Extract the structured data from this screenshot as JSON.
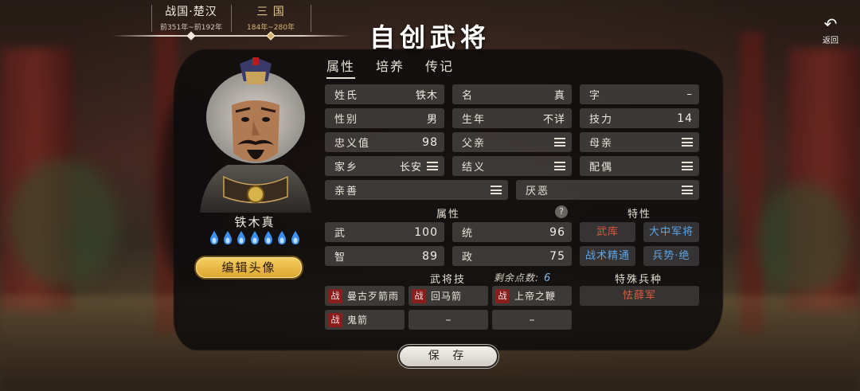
{
  "eras": [
    {
      "name": "战国·楚汉",
      "years": "前351年~前192年",
      "active": false
    },
    {
      "name": "三 国",
      "years": "184年~280年",
      "active": true
    }
  ],
  "title": "自创武将",
  "back_label": "返回",
  "tabs": [
    "属性",
    "培养",
    "传记"
  ],
  "general": {
    "name": "铁木真",
    "gem_count": 7,
    "edit_avatar_label": "编辑头像"
  },
  "info": {
    "surname_label": "姓氏",
    "surname": "铁木",
    "given_label": "名",
    "given": "真",
    "courtesy_label": "字",
    "courtesy": "–",
    "gender_label": "性别",
    "gender": "男",
    "birth_label": "生年",
    "birth": "不详",
    "skill_pts_label": "技力",
    "skill_pts": "14",
    "loyalty_label": "忠义值",
    "loyalty": "98",
    "father_label": "父亲",
    "mother_label": "母亲",
    "hometown_label": "家乡",
    "hometown": "长安",
    "sworn_label": "结义",
    "spouse_label": "配偶",
    "likes_label": "亲善",
    "dislikes_label": "厌恶"
  },
  "attributes": {
    "header": "属性",
    "help": "?",
    "war_label": "武",
    "war": "100",
    "lead_label": "统",
    "lead": "96",
    "int_label": "智",
    "int": "89",
    "pol_label": "政",
    "pol": "75"
  },
  "traits": {
    "header": "特性",
    "items": [
      {
        "label": "武库",
        "color": "red"
      },
      {
        "label": "大中军将",
        "color": "blue"
      },
      {
        "label": "战术精通",
        "color": "blue"
      },
      {
        "label": "兵势·绝",
        "color": "blue"
      }
    ]
  },
  "skills": {
    "header": "武将技",
    "remaining_label": "剩余点数:",
    "remaining": "6",
    "badge": "战",
    "items": [
      "曼古歹箭雨",
      "回马箭",
      "上帝之鞭",
      "鬼箭"
    ],
    "empty": "–"
  },
  "troop": {
    "header": "特殊兵种",
    "value": "怯薛军"
  },
  "save_label": "保 存"
}
